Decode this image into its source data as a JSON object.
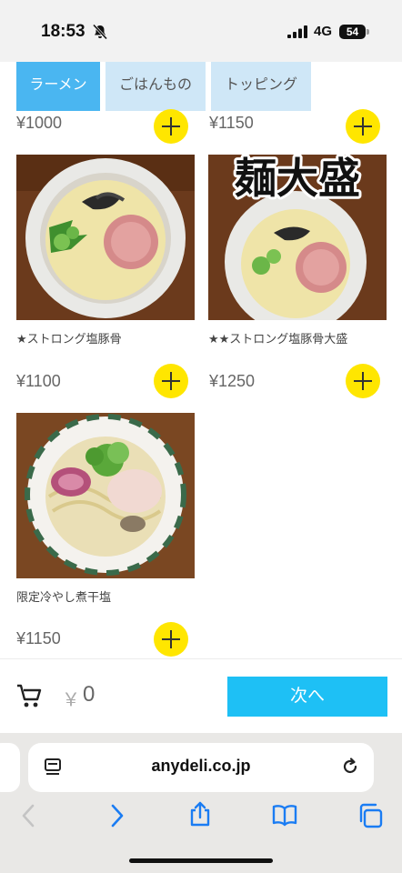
{
  "status_bar": {
    "time": "18:53",
    "network": "4G",
    "battery": "54"
  },
  "tabs": [
    {
      "label": "ラーメン",
      "active": true
    },
    {
      "label": "ごはんもの",
      "active": false
    },
    {
      "label": "トッピング",
      "active": false
    }
  ],
  "products": [
    {
      "name": "",
      "price": "¥1000"
    },
    {
      "name": "",
      "price": "¥1150"
    },
    {
      "name": "★ストロング塩豚骨",
      "price": "¥1100"
    },
    {
      "name": "★★ストロング塩豚骨大盛",
      "price": "¥1250",
      "image_text": "麺大盛"
    },
    {
      "name": "限定冷やし煮干塩",
      "price": "¥1150"
    }
  ],
  "cart": {
    "currency": "￥",
    "total": "0",
    "next_label": "次へ"
  },
  "browser": {
    "url": "anydeli.co.jp"
  },
  "colors": {
    "tab_active": "#4ab6f1",
    "tab_inactive": "#cfe7f7",
    "add_button": "#ffe600",
    "next_button": "#1ec0f5",
    "ios_blue": "#1a7cf3"
  }
}
